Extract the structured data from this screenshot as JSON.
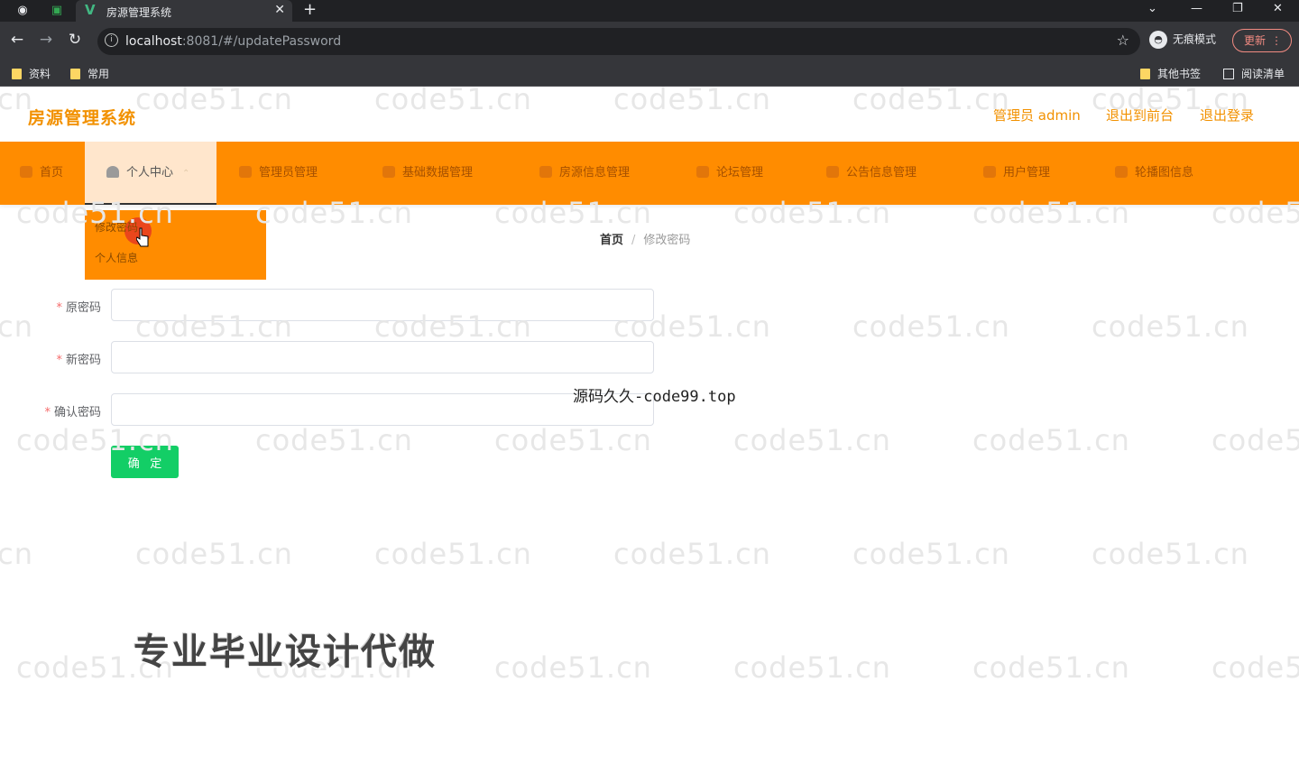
{
  "browser": {
    "tab_title": "房源管理系统",
    "url_host": "localhost",
    "url_rest": ":8081/#/updatePassword",
    "incognito_label": "无痕模式",
    "update_label": "更新",
    "bookmarks": [
      "资料",
      "常用"
    ],
    "bookmarks_right": [
      "其他书签",
      "阅读清单"
    ]
  },
  "header": {
    "logo": "房源管理系统",
    "user": "管理员 admin",
    "to_front": "退出到前台",
    "logout": "退出登录"
  },
  "nav": {
    "items": [
      "首页",
      "个人中心",
      "管理员管理",
      "基础数据管理",
      "房源信息管理",
      "论坛管理",
      "公告信息管理",
      "用户管理",
      "轮播图信息"
    ]
  },
  "dropdown": {
    "items": [
      "修改密码",
      "个人信息"
    ]
  },
  "breadcrumb": {
    "home": "首页",
    "separator": "/",
    "current": "修改密码"
  },
  "form": {
    "old_password_label": "原密码",
    "new_password_label": "新密码",
    "confirm_password_label": "确认密码",
    "required_mark": "*",
    "submit": "确 定"
  },
  "watermark": "code51.cn",
  "overlay_note": "源码久久-code99.top",
  "promo": "专业毕业设计代做",
  "colors": {
    "nav_bg": "#ff8c00",
    "brand_text": "#f29100",
    "submit_bg": "#13ce66"
  }
}
